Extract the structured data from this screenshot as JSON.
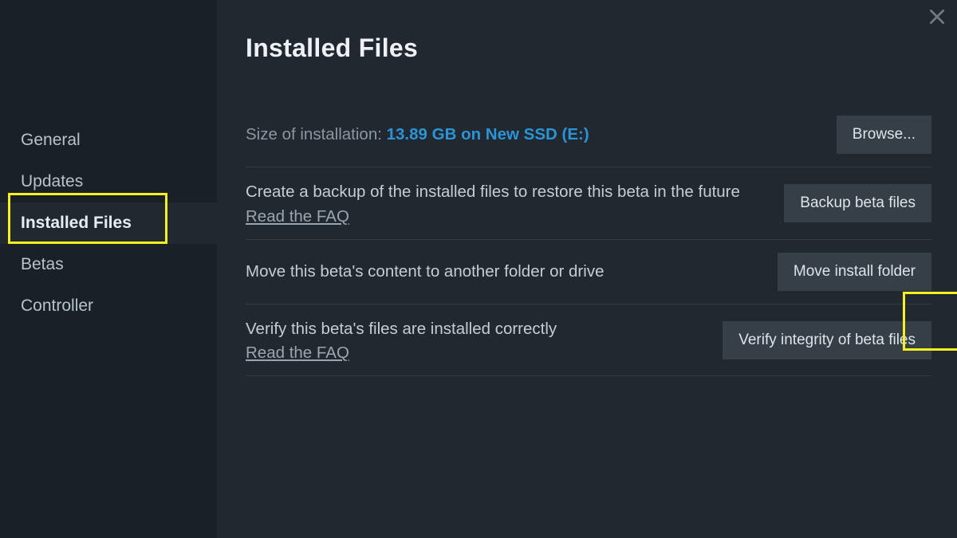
{
  "sidebar": {
    "items": [
      {
        "label": "General"
      },
      {
        "label": "Updates"
      },
      {
        "label": "Installed Files"
      },
      {
        "label": "Betas"
      },
      {
        "label": "Controller"
      }
    ],
    "active_index": 2
  },
  "page": {
    "title": "Installed Files"
  },
  "size_row": {
    "label": "Size of installation: ",
    "value": "13.89 GB on New SSD (E:)",
    "button": "Browse..."
  },
  "backup_row": {
    "desc": "Create a backup of the installed files to restore this beta in the future",
    "faq": "Read the FAQ",
    "button": "Backup beta files"
  },
  "move_row": {
    "desc": "Move this beta's content to another folder or drive",
    "button": "Move install folder"
  },
  "verify_row": {
    "desc": "Verify this beta's files are installed correctly",
    "faq": "Read the FAQ",
    "button": "Verify integrity of beta files"
  }
}
